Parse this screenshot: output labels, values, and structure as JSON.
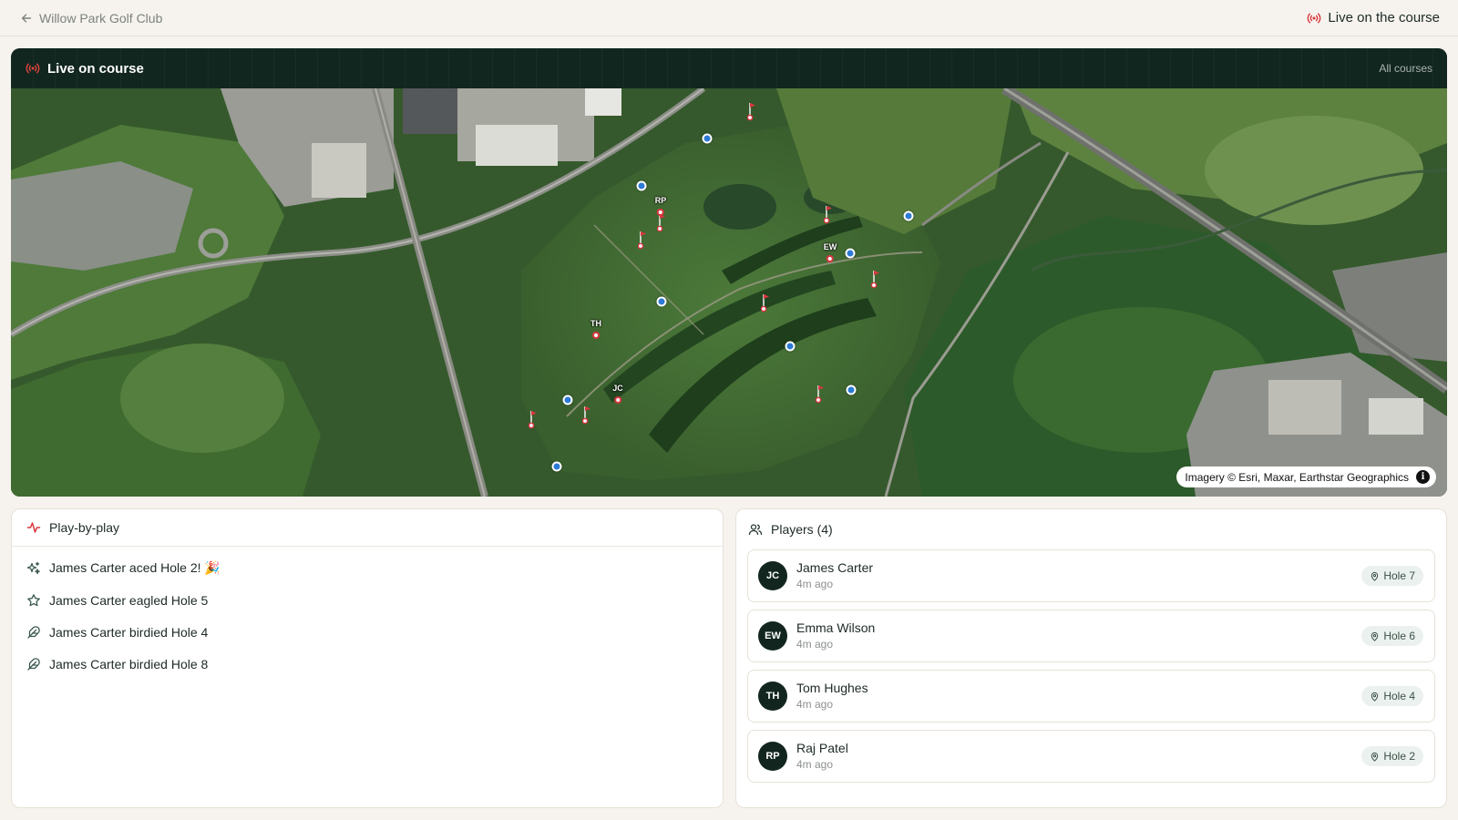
{
  "header": {
    "back_label": "Willow Park Golf Club",
    "live_label": "Live on the course"
  },
  "map": {
    "title": "Live on course",
    "all_courses": "All courses",
    "attribution": "Imagery © Esri, Maxar, Earthstar Geographics",
    "player_markers": [
      "RP",
      "EW",
      "TH",
      "JC"
    ]
  },
  "play_by_play": {
    "title": "Play-by-play",
    "items": [
      {
        "text": "James Carter aced Hole 2! 🎉",
        "icon": "sparkles-icon"
      },
      {
        "text": "James Carter eagled Hole 5",
        "icon": "star-icon"
      },
      {
        "text": "James Carter birdied Hole 4",
        "icon": "feather-icon"
      },
      {
        "text": "James Carter birdied Hole 8",
        "icon": "feather-icon"
      }
    ]
  },
  "players": {
    "title": "Players (4)",
    "items": [
      {
        "initials": "JC",
        "name": "James Carter",
        "time": "4m ago",
        "hole": "Hole 7"
      },
      {
        "initials": "EW",
        "name": "Emma Wilson",
        "time": "4m ago",
        "hole": "Hole 6"
      },
      {
        "initials": "TH",
        "name": "Tom Hughes",
        "time": "4m ago",
        "hole": "Hole 4"
      },
      {
        "initials": "RP",
        "name": "Raj Patel",
        "time": "4m ago",
        "hole": "Hole 2"
      }
    ]
  },
  "colors": {
    "accent_red": "#d9363e",
    "tee_blue": "#2d7ad6",
    "dark_green": "#122620",
    "page_bg": "#f6f3ee"
  }
}
